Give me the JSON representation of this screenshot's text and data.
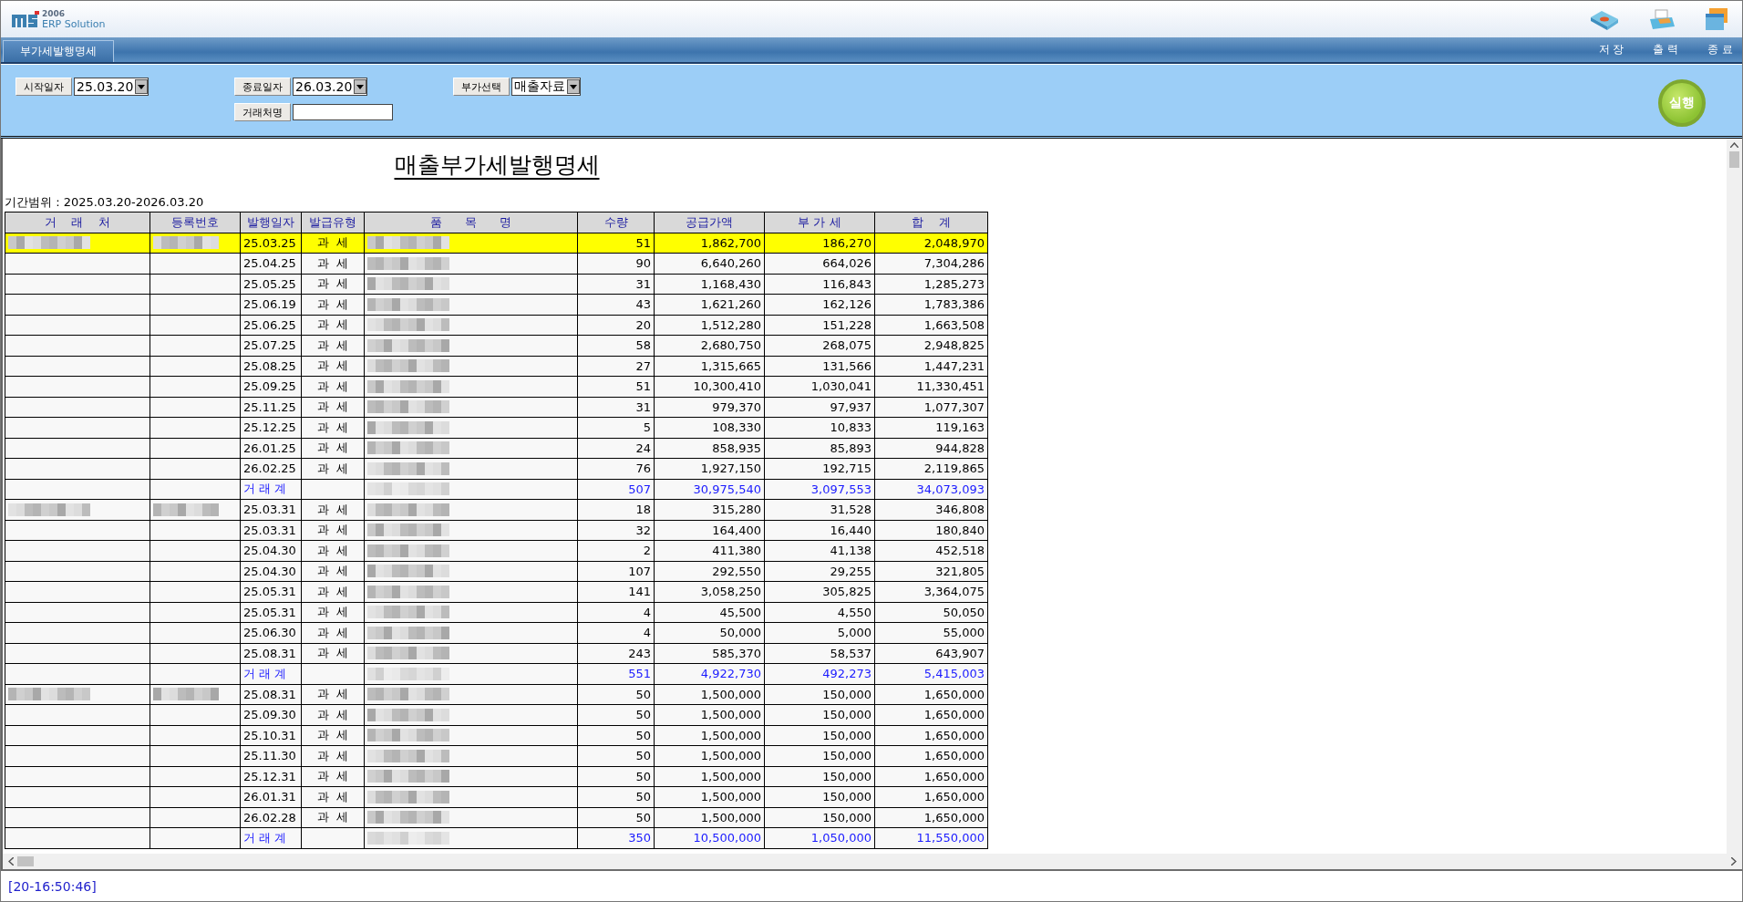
{
  "app": {
    "logo_year": "2006",
    "logo_name": "ERP Solution"
  },
  "tab": {
    "label": "부가세발행명세",
    "selected": true
  },
  "toolbar": [
    {
      "label": "저 장",
      "kind": "save"
    },
    {
      "label": "출 력",
      "kind": "print"
    },
    {
      "label": "종 료",
      "kind": "exit"
    }
  ],
  "filters": [
    {
      "label": "시작일자",
      "kind": "combo",
      "value": "25.03.20"
    },
    {
      "label": "종료일자",
      "kind": "combo",
      "value": "26.03.20"
    },
    {
      "label": "부가선택",
      "kind": "combo",
      "value": "매출자료"
    },
    {
      "label": "거래처명",
      "kind": "text"
    }
  ],
  "run_button": "실행",
  "report": {
    "title": "매출부가세발행명세",
    "period": "기간범위 : 2025.03.20-2026.03.20",
    "columns": [
      "거    래    처",
      "등록번호",
      "발행일자",
      "발급유형",
      "품      목      명",
      "수량",
      "공급가액",
      "부 가 세",
      "합    계"
    ],
    "rows": [
      {
        "kind": "item",
        "selected": true,
        "customer_blurred": true,
        "date": "25.03.25",
        "type": "과  세",
        "qty": "51",
        "supply": "1,862,700",
        "vat": "186,270",
        "total": "2,048,970"
      },
      {
        "kind": "item",
        "selected": false,
        "customer_blurred": false,
        "date": "25.04.25",
        "type": "과  세",
        "qty": "90",
        "supply": "6,640,260",
        "vat": "664,026",
        "total": "7,304,286"
      },
      {
        "kind": "item",
        "selected": false,
        "customer_blurred": false,
        "date": "25.05.25",
        "type": "과  세",
        "qty": "31",
        "supply": "1,168,430",
        "vat": "116,843",
        "total": "1,285,273"
      },
      {
        "kind": "item",
        "selected": false,
        "customer_blurred": false,
        "date": "25.06.19",
        "type": "과  세",
        "qty": "43",
        "supply": "1,621,260",
        "vat": "162,126",
        "total": "1,783,386"
      },
      {
        "kind": "item",
        "selected": false,
        "customer_blurred": false,
        "date": "25.06.25",
        "type": "과  세",
        "qty": "20",
        "supply": "1,512,280",
        "vat": "151,228",
        "total": "1,663,508"
      },
      {
        "kind": "item",
        "selected": false,
        "customer_blurred": false,
        "date": "25.07.25",
        "type": "과  세",
        "qty": "58",
        "supply": "2,680,750",
        "vat": "268,075",
        "total": "2,948,825"
      },
      {
        "kind": "item",
        "selected": false,
        "customer_blurred": false,
        "date": "25.08.25",
        "type": "과  세",
        "qty": "27",
        "supply": "1,315,665",
        "vat": "131,566",
        "total": "1,447,231"
      },
      {
        "kind": "item",
        "selected": false,
        "customer_blurred": false,
        "date": "25.09.25",
        "type": "과  세",
        "qty": "51",
        "supply": "10,300,410",
        "vat": "1,030,041",
        "total": "11,330,451"
      },
      {
        "kind": "item",
        "selected": false,
        "customer_blurred": false,
        "date": "25.11.25",
        "type": "과  세",
        "qty": "31",
        "supply": "979,370",
        "vat": "97,937",
        "total": "1,077,307"
      },
      {
        "kind": "item",
        "selected": false,
        "customer_blurred": false,
        "date": "25.12.25",
        "type": "과  세",
        "qty": "5",
        "supply": "108,330",
        "vat": "10,833",
        "total": "119,163"
      },
      {
        "kind": "item",
        "selected": false,
        "customer_blurred": false,
        "date": "26.01.25",
        "type": "과  세",
        "qty": "24",
        "supply": "858,935",
        "vat": "85,893",
        "total": "944,828"
      },
      {
        "kind": "item",
        "selected": false,
        "customer_blurred": false,
        "date": "26.02.25",
        "type": "과  세",
        "qty": "76",
        "supply": "1,927,150",
        "vat": "192,715",
        "total": "2,119,865"
      },
      {
        "kind": "subtotal",
        "selected": false,
        "customer_blurred": false,
        "date": "거 래 계",
        "qty": "507",
        "supply": "30,975,540",
        "vat": "3,097,553",
        "total": "34,073,093"
      },
      {
        "kind": "item",
        "selected": false,
        "customer_blurred": true,
        "date": "25.03.31",
        "type": "과  세",
        "qty": "18",
        "supply": "315,280",
        "vat": "31,528",
        "total": "346,808"
      },
      {
        "kind": "item",
        "selected": false,
        "customer_blurred": false,
        "date": "25.03.31",
        "type": "과  세",
        "qty": "32",
        "supply": "164,400",
        "vat": "16,440",
        "total": "180,840"
      },
      {
        "kind": "item",
        "selected": false,
        "customer_blurred": false,
        "date": "25.04.30",
        "type": "과  세",
        "qty": "2",
        "supply": "411,380",
        "vat": "41,138",
        "total": "452,518"
      },
      {
        "kind": "item",
        "selected": false,
        "customer_blurred": false,
        "date": "25.04.30",
        "type": "과  세",
        "qty": "107",
        "supply": "292,550",
        "vat": "29,255",
        "total": "321,805"
      },
      {
        "kind": "item",
        "selected": false,
        "customer_blurred": false,
        "date": "25.05.31",
        "type": "과  세",
        "qty": "141",
        "supply": "3,058,250",
        "vat": "305,825",
        "total": "3,364,075"
      },
      {
        "kind": "item",
        "selected": false,
        "customer_blurred": false,
        "date": "25.05.31",
        "type": "과  세",
        "qty": "4",
        "supply": "45,500",
        "vat": "4,550",
        "total": "50,050"
      },
      {
        "kind": "item",
        "selected": false,
        "customer_blurred": false,
        "date": "25.06.30",
        "type": "과  세",
        "qty": "4",
        "supply": "50,000",
        "vat": "5,000",
        "total": "55,000"
      },
      {
        "kind": "item",
        "selected": false,
        "customer_blurred": false,
        "date": "25.08.31",
        "type": "과  세",
        "qty": "243",
        "supply": "585,370",
        "vat": "58,537",
        "total": "643,907"
      },
      {
        "kind": "subtotal",
        "selected": false,
        "customer_blurred": false,
        "date": "거 래 계",
        "qty": "551",
        "supply": "4,922,730",
        "vat": "492,273",
        "total": "5,415,003"
      },
      {
        "kind": "item",
        "selected": false,
        "customer_blurred": true,
        "date": "25.08.31",
        "type": "과  세",
        "qty": "50",
        "supply": "1,500,000",
        "vat": "150,000",
        "total": "1,650,000"
      },
      {
        "kind": "item",
        "selected": false,
        "customer_blurred": false,
        "date": "25.09.30",
        "type": "과  세",
        "qty": "50",
        "supply": "1,500,000",
        "vat": "150,000",
        "total": "1,650,000"
      },
      {
        "kind": "item",
        "selected": false,
        "customer_blurred": false,
        "date": "25.10.31",
        "type": "과  세",
        "qty": "50",
        "supply": "1,500,000",
        "vat": "150,000",
        "total": "1,650,000"
      },
      {
        "kind": "item",
        "selected": false,
        "customer_blurred": false,
        "date": "25.11.30",
        "type": "과  세",
        "qty": "50",
        "supply": "1,500,000",
        "vat": "150,000",
        "total": "1,650,000"
      },
      {
        "kind": "item",
        "selected": false,
        "customer_blurred": false,
        "date": "25.12.31",
        "type": "과  세",
        "qty": "50",
        "supply": "1,500,000",
        "vat": "150,000",
        "total": "1,650,000"
      },
      {
        "kind": "item",
        "selected": false,
        "customer_blurred": false,
        "date": "26.01.31",
        "type": "과  세",
        "qty": "50",
        "supply": "1,500,000",
        "vat": "150,000",
        "total": "1,650,000"
      },
      {
        "kind": "item",
        "selected": false,
        "customer_blurred": false,
        "date": "26.02.28",
        "type": "과  세",
        "qty": "50",
        "supply": "1,500,000",
        "vat": "150,000",
        "total": "1,650,000"
      },
      {
        "kind": "subtotal",
        "selected": false,
        "customer_blurred": false,
        "date": "거 래 계",
        "qty": "350",
        "supply": "10,500,000",
        "vat": "1,050,000",
        "total": "11,550,000"
      }
    ]
  },
  "status_bar": "[20-16:50:46]"
}
